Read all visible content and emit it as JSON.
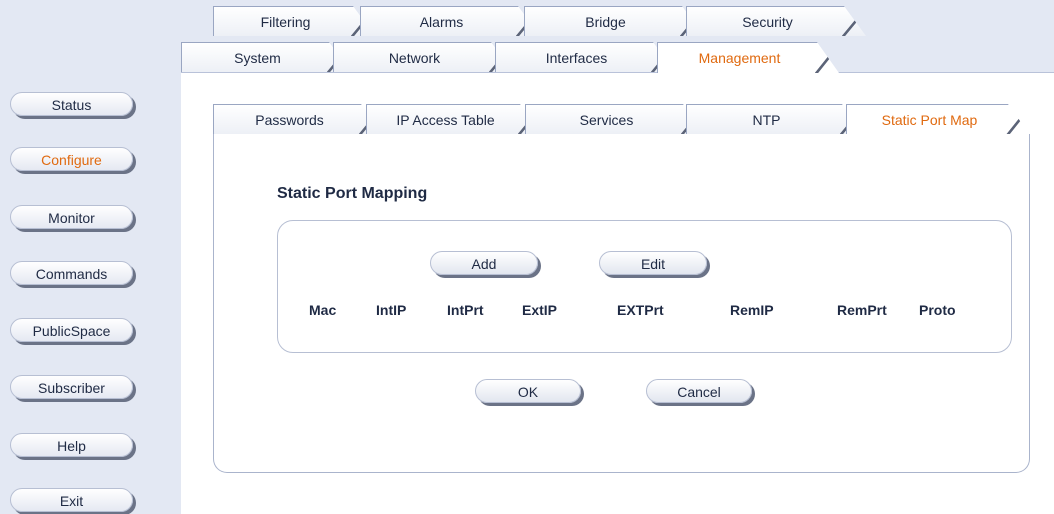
{
  "top_tabs_row1": [
    "Filtering",
    "Alarms",
    "Bridge",
    "Security"
  ],
  "top_tabs_row2": [
    "System",
    "Network",
    "Interfaces",
    "Management"
  ],
  "active_top_tab": "Management",
  "sub_tabs": [
    "Passwords",
    "IP Access Table",
    "Services",
    "NTP",
    "Static Port Map"
  ],
  "active_sub_tab": "Static Port Map",
  "sidebar": {
    "items": [
      {
        "label": "Status"
      },
      {
        "label": "Configure"
      },
      {
        "label": "Monitor"
      },
      {
        "label": "Commands"
      },
      {
        "label": "PublicSpace"
      },
      {
        "label": "Subscriber"
      },
      {
        "label": "Help"
      },
      {
        "label": "Exit"
      }
    ],
    "active": "Configure"
  },
  "page": {
    "title": "Static Port Mapping",
    "add_label": "Add",
    "edit_label": "Edit",
    "columns": [
      "Mac",
      "IntIP",
      "IntPrt",
      "ExtIP",
      "EXTPrt",
      "RemIP",
      "RemPrt",
      "Proto"
    ],
    "ok_label": "OK",
    "cancel_label": "Cancel"
  },
  "colors": {
    "accent": "#e06a10",
    "text": "#1f2a44",
    "sidebar_bg": "#e3e8f3"
  }
}
